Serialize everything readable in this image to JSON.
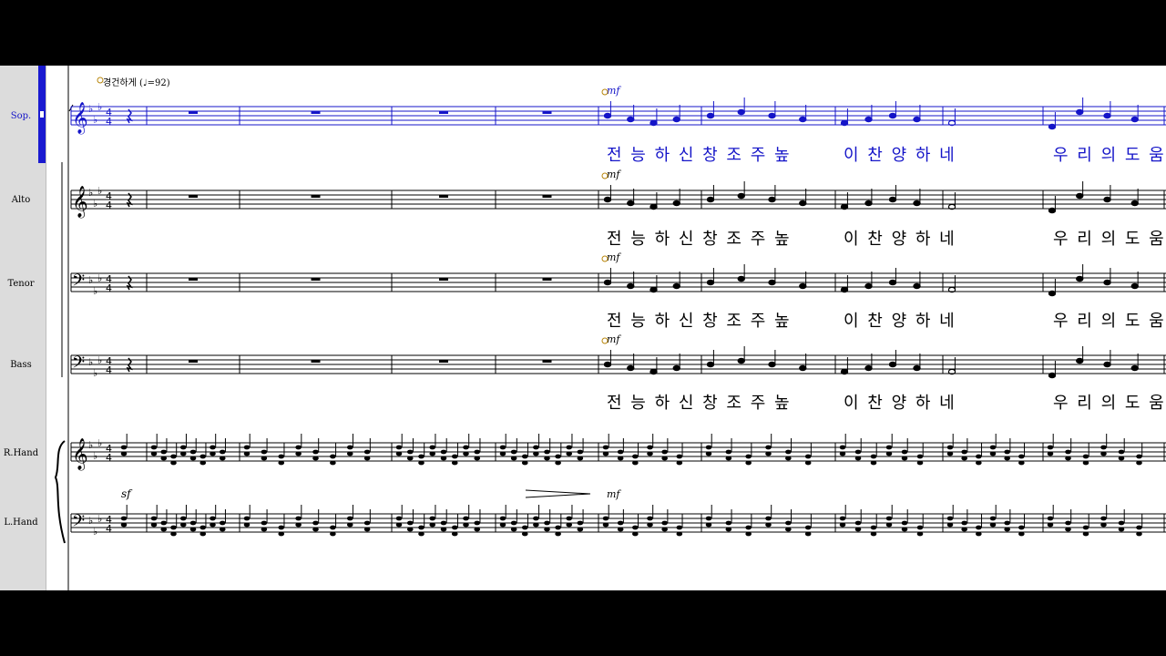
{
  "tempo_marking": "경건하게 (♩=92)",
  "staves": [
    {
      "id": "sop",
      "label": "Sop.",
      "selected": true
    },
    {
      "id": "alto",
      "label": "Alto",
      "selected": false
    },
    {
      "id": "tenor",
      "label": "Tenor",
      "selected": false
    },
    {
      "id": "bass",
      "label": "Bass",
      "selected": false
    },
    {
      "id": "rhand",
      "label": "R.Hand",
      "selected": false
    },
    {
      "id": "lhand",
      "label": "L.Hand",
      "selected": false
    }
  ],
  "time_signature": "4/4",
  "key_signature": "3 flats",
  "dynamics": {
    "mf": "mf",
    "sf": "sf"
  },
  "lyrics": {
    "seg1": "전 능 하 신 창 조 주 높",
    "seg2": "이 찬 양 하  네",
    "seg3": "우 리 의 도 움"
  },
  "colors": {
    "selected": "#1414c8",
    "background": "#ffffff",
    "sidebar": "#dcdcdc",
    "frame": "#000000"
  }
}
